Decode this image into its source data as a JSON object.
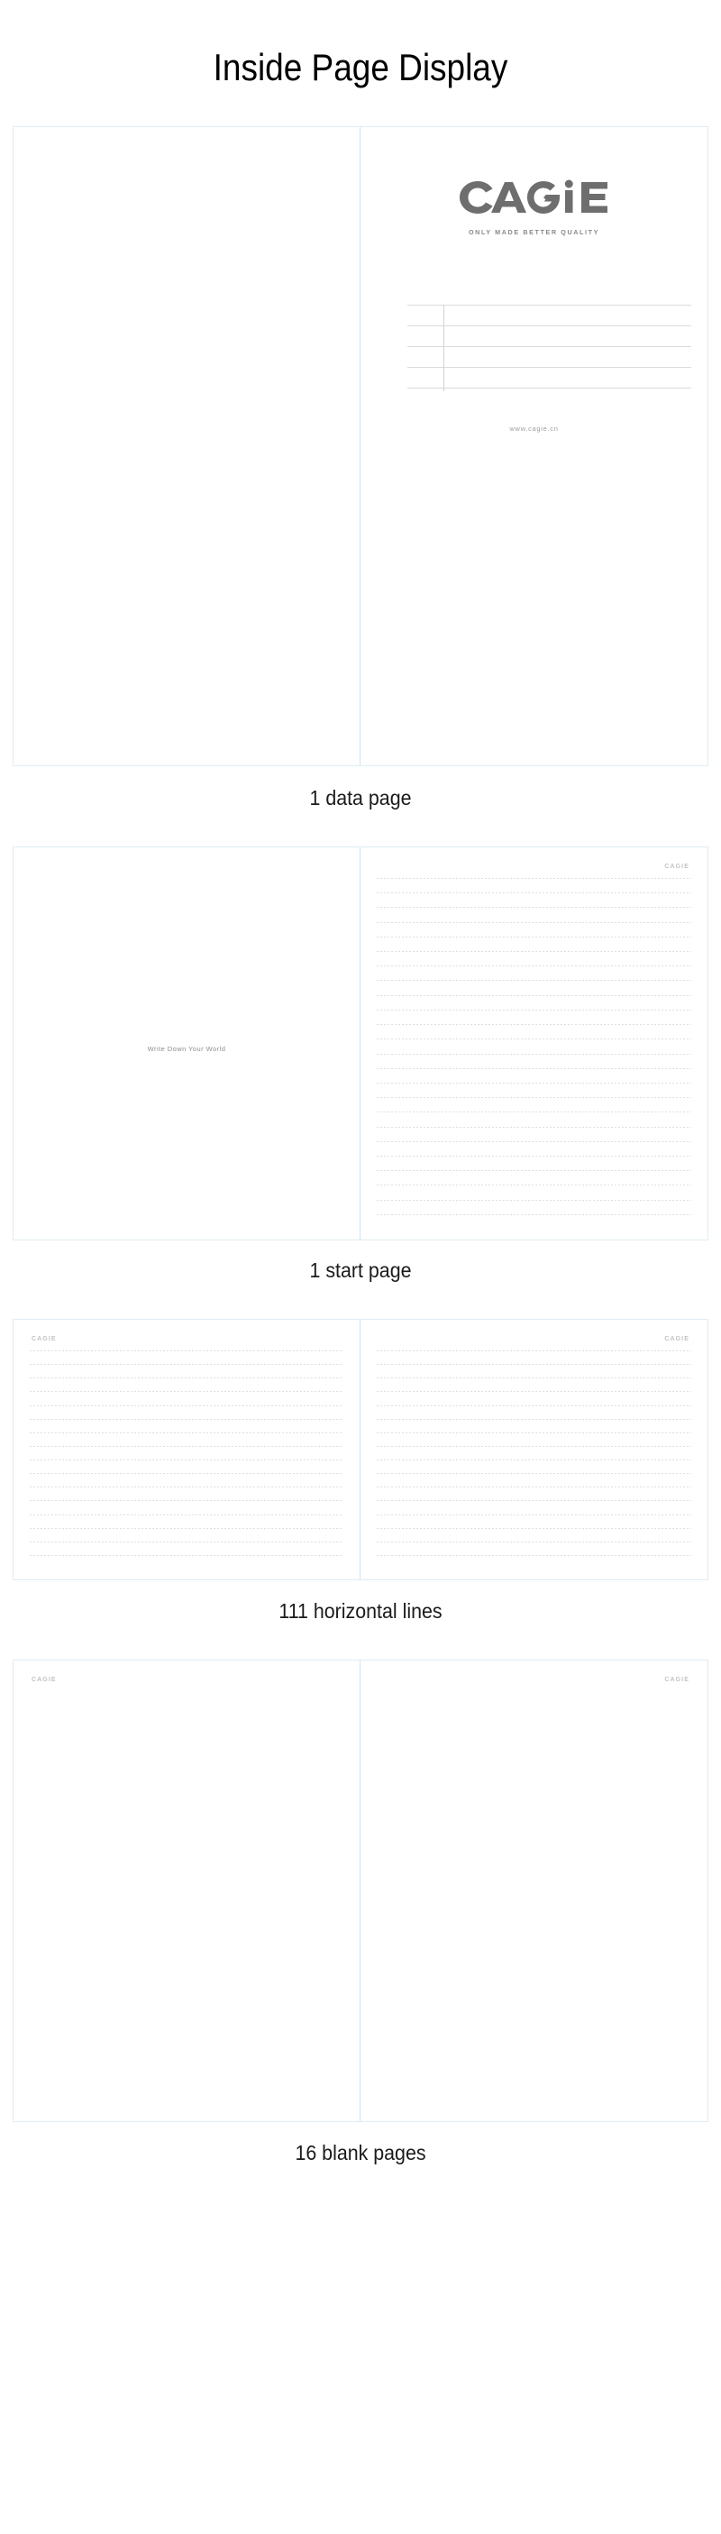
{
  "header": {
    "title": "Inside Page Display"
  },
  "brand": {
    "name": "CAGiE",
    "letters_before": "CA",
    "letters_after": "iE",
    "tagline": "ONLY MADE BETTER QUALITY",
    "website": "www.cagie.cn",
    "watermark": "CAGIE",
    "logo_color": "#6e6e6e",
    "tagline_color": "#8a8a8a",
    "watermark_color": "#c3c3c3"
  },
  "theme": {
    "frame_border": "#dfedf5",
    "spine_divider": "#cfe3f0",
    "rule_line": "#dadde1",
    "form_line": "#dbdbdb",
    "background": "#ffffff",
    "caption_color": "#1a1a1a"
  },
  "sections": [
    {
      "id": "data-page",
      "caption": "1 data page",
      "left_page": {
        "type": "blank"
      },
      "right_page": {
        "type": "data",
        "brand_visible": true,
        "form": {
          "horizontal_lines": 5,
          "vertical_lines": 1
        },
        "footer_text": "www.cagie.cn"
      }
    },
    {
      "id": "start-page",
      "caption": "1 start page",
      "left_page": {
        "type": "start",
        "phrase": "Write Down Your World"
      },
      "right_page": {
        "type": "ruled",
        "watermark": "CAGIE",
        "watermark_position": "top-right",
        "line_count": 24
      }
    },
    {
      "id": "horizontal-lines",
      "caption": "111 horizontal lines",
      "left_page": {
        "type": "ruled",
        "watermark": "CAGIE",
        "watermark_position": "top-left",
        "line_count": 16
      },
      "right_page": {
        "type": "ruled",
        "watermark": "CAGIE",
        "watermark_position": "top-right",
        "line_count": 16
      }
    },
    {
      "id": "blank-pages",
      "caption": "16 blank pages",
      "left_page": {
        "type": "blank-watermarked",
        "watermark": "CAGIE",
        "watermark_position": "top-left"
      },
      "right_page": {
        "type": "blank-watermarked",
        "watermark": "CAGIE",
        "watermark_position": "top-right"
      }
    }
  ]
}
